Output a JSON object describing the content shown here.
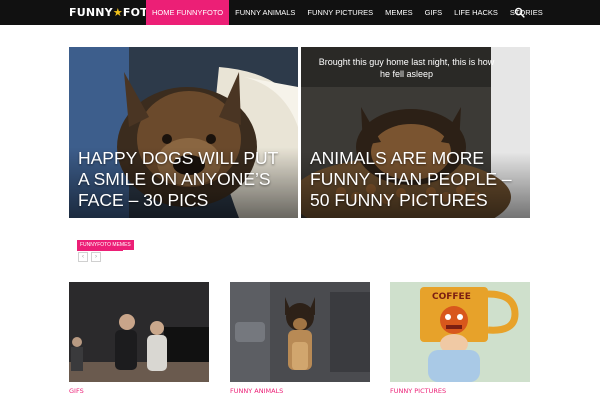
{
  "nav": {
    "logo_text": "FUNNYFOTO",
    "items": [
      {
        "label": "HOME FUNNYFOTO",
        "active": true
      },
      {
        "label": "FUNNY ANIMALS",
        "active": false
      },
      {
        "label": "FUNNY PICTURES",
        "active": false
      },
      {
        "label": "MEMES",
        "active": false
      },
      {
        "label": "GIFS",
        "active": false
      },
      {
        "label": "LIFE HACKS",
        "active": false
      },
      {
        "label": "STORIES",
        "active": false
      }
    ],
    "search_icon": "search-icon"
  },
  "hero": [
    {
      "title": "HAPPY DOGS WILL PUT A SMILE ON ANYONE’S FACE – 30 PICS",
      "caption": ""
    },
    {
      "title": "ANIMALS ARE MORE FUNNY THAN PEOPLE – 50 FUNNY PICTURES",
      "caption": "Brought this guy home last night, this is how he fell asleep"
    }
  ],
  "recent": {
    "tab_label": "FUNNYFOTO MEMES",
    "prev": "‹",
    "next": "›"
  },
  "cards": [
    {
      "category": "GIFS"
    },
    {
      "category": "FUNNY ANIMALS"
    },
    {
      "category": "FUNNY PICTURES"
    }
  ],
  "colors": {
    "accent": "#ec1f76",
    "nav_bg": "#111111",
    "logo_star": "#f2c21b"
  }
}
